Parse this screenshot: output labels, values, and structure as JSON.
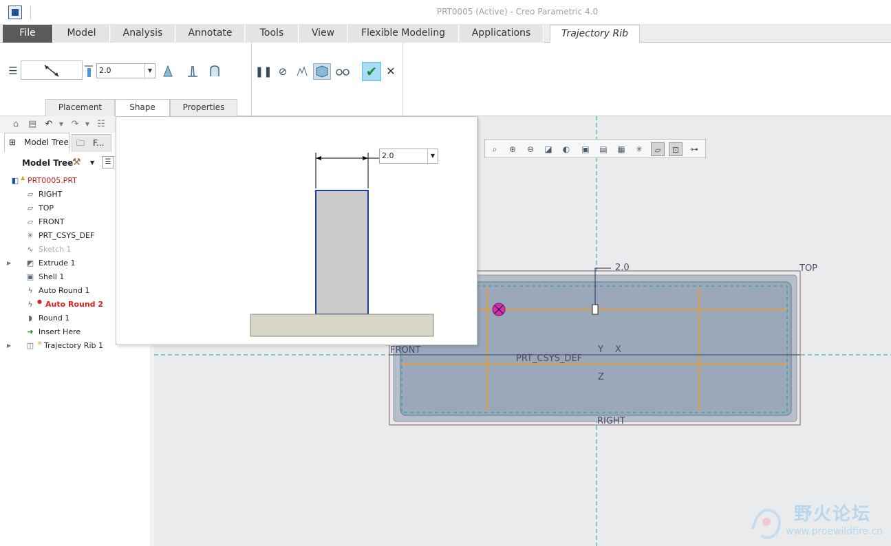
{
  "window": {
    "title": "PRT0005 (Active) - Creo Parametric 4.0"
  },
  "ribbon_tabs": [
    "File",
    "Model",
    "Analysis",
    "Annotate",
    "Tools",
    "View",
    "Flexible Modeling",
    "Applications",
    "Trajectory Rib"
  ],
  "ribbon": {
    "thickness_value": "2.0",
    "subtabs": [
      "Placement",
      "Shape",
      "Properties"
    ],
    "active_subtab": "Shape"
  },
  "panel_tabs": {
    "model_tree": "Model Tree",
    "folder": "F..."
  },
  "model_tree": {
    "header": "Model Tree",
    "items": [
      {
        "label": "PRT0005.PRT",
        "icon": "part-icon",
        "expandable": false
      },
      {
        "label": "RIGHT",
        "icon": "datum-plane-icon",
        "expandable": false
      },
      {
        "label": "TOP",
        "icon": "datum-plane-icon",
        "expandable": false
      },
      {
        "label": "FRONT",
        "icon": "datum-plane-icon",
        "expandable": false
      },
      {
        "label": "PRT_CSYS_DEF",
        "icon": "csys-icon",
        "expandable": false
      },
      {
        "label": "Sketch 1",
        "icon": "sketch-icon",
        "expandable": false
      },
      {
        "label": "Extrude 1",
        "icon": "extrude-icon",
        "expandable": true
      },
      {
        "label": "Shell 1",
        "icon": "shell-icon",
        "expandable": false
      },
      {
        "label": "Auto Round 1",
        "icon": "auto-round-icon",
        "expandable": false
      },
      {
        "label": "Auto Round 2",
        "icon": "auto-round-icon",
        "expandable": false
      },
      {
        "label": "Round 1",
        "icon": "round-icon",
        "expandable": false
      },
      {
        "label": "Insert Here",
        "icon": "insert-arrow-icon",
        "expandable": false
      },
      {
        "label": "Trajectory Rib 1",
        "icon": "trajectory-rib-icon",
        "expandable": true
      }
    ]
  },
  "shape_panel": {
    "dimension_value": "2.0"
  },
  "viewport": {
    "dim_value": "2.0",
    "labels": {
      "top": "TOP",
      "front": "FRONT",
      "right": "RIGHT",
      "csys": "PRT_CSYS_DEF",
      "y": "Y",
      "x": "X",
      "z": "Z"
    }
  },
  "watermark": {
    "cn": "野火论坛",
    "url": "www.proewildfire.cn"
  },
  "colors": {
    "accent_blue": "#1f4f9a",
    "error_red": "#d42020",
    "ok_green": "#1d8a3a",
    "rib_edge": "#1a3fa0",
    "datum_cyan": "#1aa0a8",
    "sketch_orange": "#e0a040"
  }
}
